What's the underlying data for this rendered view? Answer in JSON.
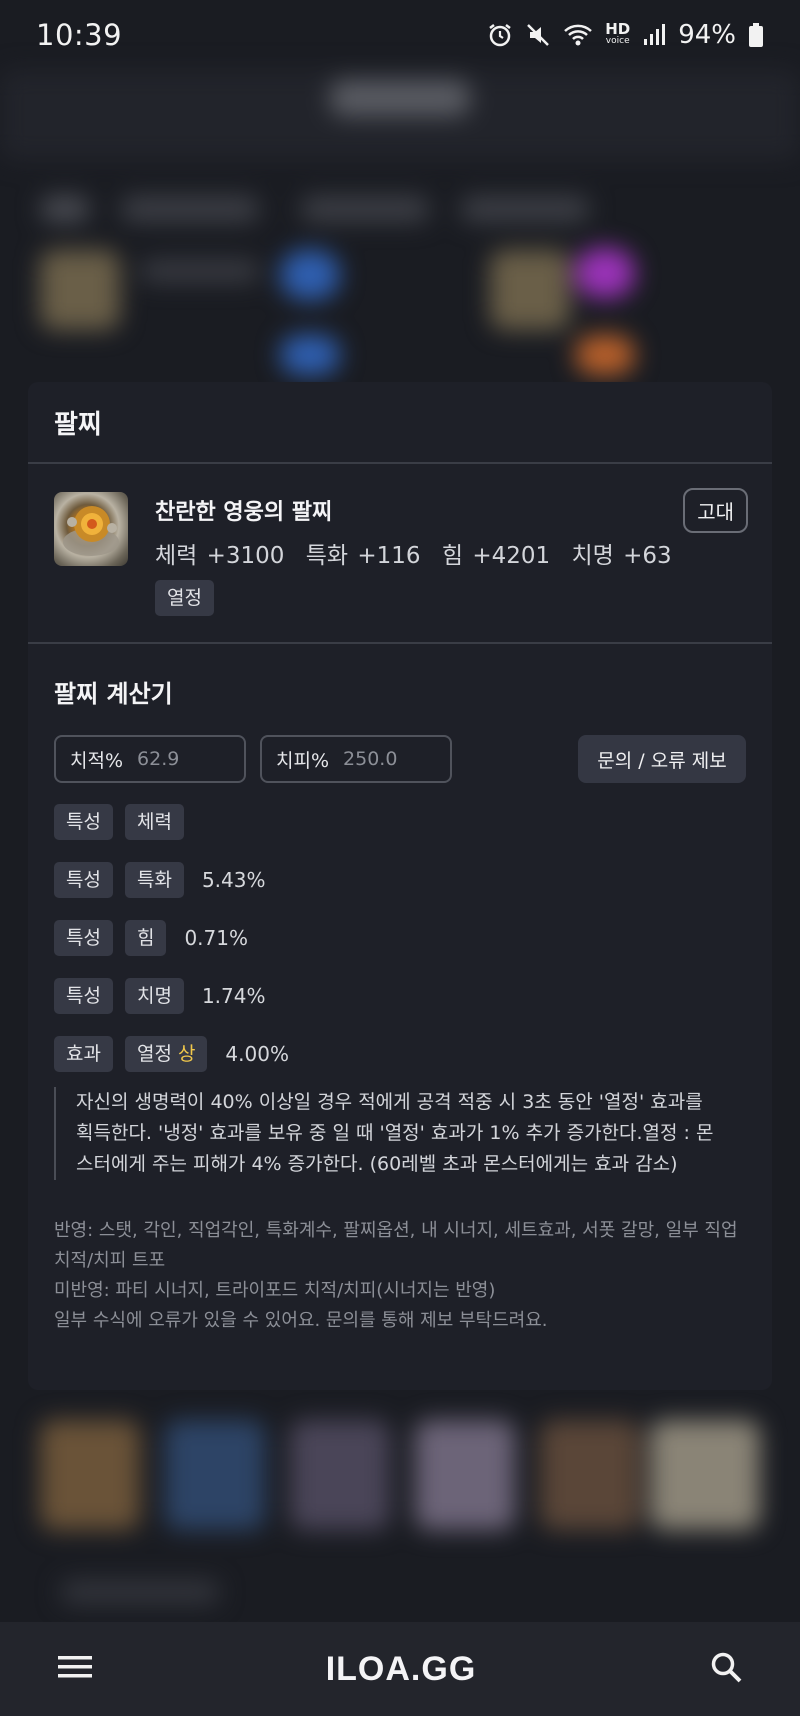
{
  "status_bar": {
    "time": "10:39",
    "battery": "94%",
    "network_label": "HD",
    "network_sublabel": "voice",
    "icons": [
      "alarm-icon",
      "mute-icon",
      "wifi-icon",
      "hd-voice-icon",
      "signal-icon",
      "battery-icon"
    ]
  },
  "modal": {
    "title": "팔찌",
    "item": {
      "name": "찬란한 영웅의 팔찌",
      "stats": [
        "체력 +3100",
        "특화 +116",
        "힘 +4201",
        "치명 +63"
      ],
      "tag": "열정",
      "grade": "고대"
    },
    "calculator": {
      "title": "팔찌 계산기",
      "crit_rate_label": "치적%",
      "crit_rate_value": "62.9",
      "crit_damage_label": "치피%",
      "crit_damage_value": "250.0",
      "report_button": "문의 / 오류 제보",
      "rows": [
        {
          "kind": "특성",
          "name": "체력",
          "value": ""
        },
        {
          "kind": "특성",
          "name": "특화",
          "value": "5.43%"
        },
        {
          "kind": "특성",
          "name": "힘",
          "value": "0.71%"
        },
        {
          "kind": "특성",
          "name": "치명",
          "value": "1.74%"
        }
      ],
      "effect_row": {
        "kind": "효과",
        "name": "열정",
        "grade": "상",
        "value": "4.00%"
      },
      "effect_description": "자신의 생명력이 40% 이상일 경우 적에게 공격 적중 시 3초 동안 '열정' 효과를 획득한다. '냉정' 효과를 보유 중 일 때 '열정' 효과가 1% 추가 증가한다.열정 : 몬스터에게 주는 피해가 4% 증가한다. (60레벨 초과 몬스터에게는 효과 감소)",
      "notes": [
        "반영: 스탯, 각인, 직업각인, 특화계수, 팔찌옵션, 내 시너지, 세트효과, 서폿 갈망, 일부 직업 치적/치피 트포",
        "미반영: 파티 시너지, 트라이포드 치적/치피(시너지는 반영)",
        "일부 수식에 오류가 있을 수 있어요. 문의를 통해 제보 부탁드려요."
      ]
    }
  },
  "bottom_nav": {
    "logo": "ILOA.GG",
    "menu_icon": "menu-icon",
    "search_icon": "search-icon"
  },
  "colors": {
    "background": "#1a1c22",
    "card": "#1e2028",
    "tag": "#363945",
    "grade_highlight": "#f1c84b"
  }
}
